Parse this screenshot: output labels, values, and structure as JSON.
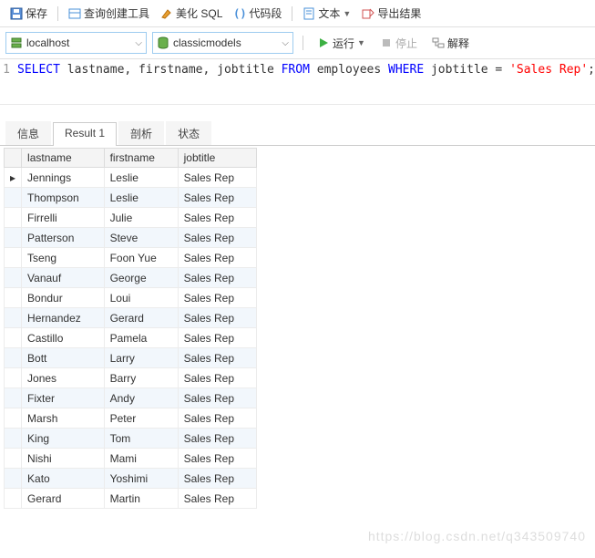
{
  "toolbar": {
    "save": "保存",
    "query_tool": "查询创建工具",
    "beautify": "美化 SQL",
    "codeseg": "代码段",
    "text": "文本",
    "export": "导出结果"
  },
  "conn": {
    "host": "localhost",
    "db": "classicmodels"
  },
  "run": {
    "run": "运行",
    "stop": "停止",
    "explain": "解释"
  },
  "editor": {
    "line": "1",
    "sql_k1": "SELECT",
    "sql_t1": " lastname, firstname, jobtitle ",
    "sql_k2": "FROM",
    "sql_t2": " employees ",
    "sql_k3": "WHERE",
    "sql_t3": " jobtitle = ",
    "sql_s1": "'Sales Rep'",
    "sql_t4": ";"
  },
  "tabs": {
    "info": "信息",
    "result": "Result 1",
    "profile": "剖析",
    "status": "状态"
  },
  "cols": {
    "c1": "lastname",
    "c2": "firstname",
    "c3": "jobtitle"
  },
  "rows": [
    {
      "ln": "Jennings",
      "fn": "Leslie",
      "jt": "Sales Rep"
    },
    {
      "ln": "Thompson",
      "fn": "Leslie",
      "jt": "Sales Rep"
    },
    {
      "ln": "Firrelli",
      "fn": "Julie",
      "jt": "Sales Rep"
    },
    {
      "ln": "Patterson",
      "fn": "Steve",
      "jt": "Sales Rep"
    },
    {
      "ln": "Tseng",
      "fn": "Foon Yue",
      "jt": "Sales Rep"
    },
    {
      "ln": "Vanauf",
      "fn": "George",
      "jt": "Sales Rep"
    },
    {
      "ln": "Bondur",
      "fn": "Loui",
      "jt": "Sales Rep"
    },
    {
      "ln": "Hernandez",
      "fn": "Gerard",
      "jt": "Sales Rep"
    },
    {
      "ln": "Castillo",
      "fn": "Pamela",
      "jt": "Sales Rep"
    },
    {
      "ln": "Bott",
      "fn": "Larry",
      "jt": "Sales Rep"
    },
    {
      "ln": "Jones",
      "fn": "Barry",
      "jt": "Sales Rep"
    },
    {
      "ln": "Fixter",
      "fn": "Andy",
      "jt": "Sales Rep"
    },
    {
      "ln": "Marsh",
      "fn": "Peter",
      "jt": "Sales Rep"
    },
    {
      "ln": "King",
      "fn": "Tom",
      "jt": "Sales Rep"
    },
    {
      "ln": "Nishi",
      "fn": "Mami",
      "jt": "Sales Rep"
    },
    {
      "ln": "Kato",
      "fn": "Yoshimi",
      "jt": "Sales Rep"
    },
    {
      "ln": "Gerard",
      "fn": "Martin",
      "jt": "Sales Rep"
    }
  ],
  "watermark": "https://blog.csdn.net/q343509740"
}
